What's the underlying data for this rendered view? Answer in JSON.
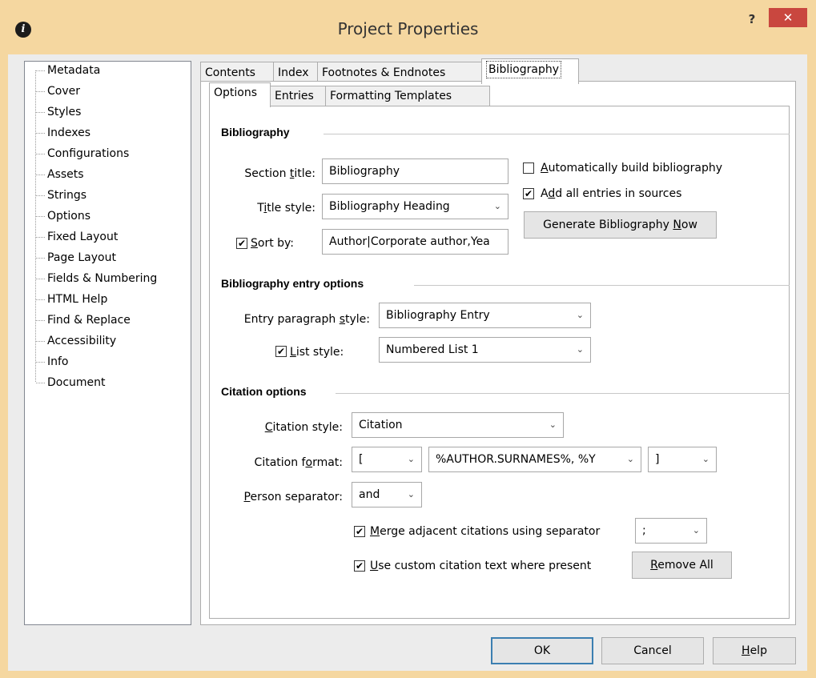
{
  "window": {
    "title": "Project Properties",
    "help_glyph": "?",
    "close_glyph": "✕",
    "app_icon": "i"
  },
  "tree": {
    "items": [
      "Metadata",
      "Cover",
      "Styles",
      "Indexes",
      "Configurations",
      "Assets",
      "Strings",
      "Options",
      "Fixed Layout",
      "Page Layout",
      "Fields & Numbering",
      "HTML Help",
      "Find & Replace",
      "Accessibility",
      "Info",
      "Document"
    ]
  },
  "tabs": [
    "Contents",
    "Index",
    "Footnotes & Endnotes",
    "Bibliography"
  ],
  "subtabs": [
    "Options",
    "Entries",
    "Formatting Templates"
  ],
  "bibliography": {
    "group_label": "Bibliography",
    "section_title": {
      "pre": "Section ",
      "key": "t",
      "post": "itle:"
    },
    "section_title_value": "Bibliography",
    "title_style": {
      "pre": "T",
      "key": "i",
      "post": "tle style:"
    },
    "title_style_value": "Bibliography Heading",
    "sort_by": {
      "pre": "",
      "key": "S",
      "post": "ort by:"
    },
    "sort_by_value": "Author|Corporate author,Yea",
    "auto_build": {
      "pre": "",
      "key": "A",
      "post": "utomatically build bibliography"
    },
    "add_all": {
      "pre": "A",
      "key": "d",
      "post": "d all entries in sources"
    },
    "generate": {
      "pre": "Generate Bibliography ",
      "key": "N",
      "post": "ow"
    }
  },
  "entry_options": {
    "group_label": "Bibliography entry options",
    "paragraph_style": {
      "pre": "Entry paragraph ",
      "key": "s",
      "post": "tyle:"
    },
    "paragraph_style_value": "Bibliography Entry",
    "list_style": {
      "pre": "",
      "key": "L",
      "post": "ist style:"
    },
    "list_style_value": "Numbered List 1"
  },
  "citation": {
    "group_label": "Citation options",
    "style": {
      "pre": "",
      "key": "C",
      "post": "itation style:"
    },
    "style_value": "Citation",
    "format": {
      "pre": "Citation f",
      "key": "o",
      "post": "rmat:"
    },
    "format_open": "[",
    "format_template": "%AUTHOR.SURNAMES%, %Y",
    "format_close": "]",
    "person_sep": {
      "pre": "",
      "key": "P",
      "post": "erson separator:"
    },
    "person_sep_value": "and",
    "merge": {
      "pre": "",
      "key": "M",
      "post": "erge adjacent citations using separator"
    },
    "merge_sep_value": ";",
    "custom_text": {
      "pre": "",
      "key": "U",
      "post": "se custom citation text where present"
    },
    "remove_all": {
      "pre": "",
      "key": "R",
      "post": "emove All"
    }
  },
  "footer": {
    "ok": "OK",
    "cancel": "Cancel",
    "help": {
      "pre": "",
      "key": "H",
      "post": "elp"
    }
  },
  "icons": {
    "check": "✔",
    "chevron": "⌄"
  },
  "checks": {
    "auto_build": false,
    "add_all": true,
    "sort_by": true,
    "list_style": true,
    "merge": true,
    "custom_text": true
  }
}
